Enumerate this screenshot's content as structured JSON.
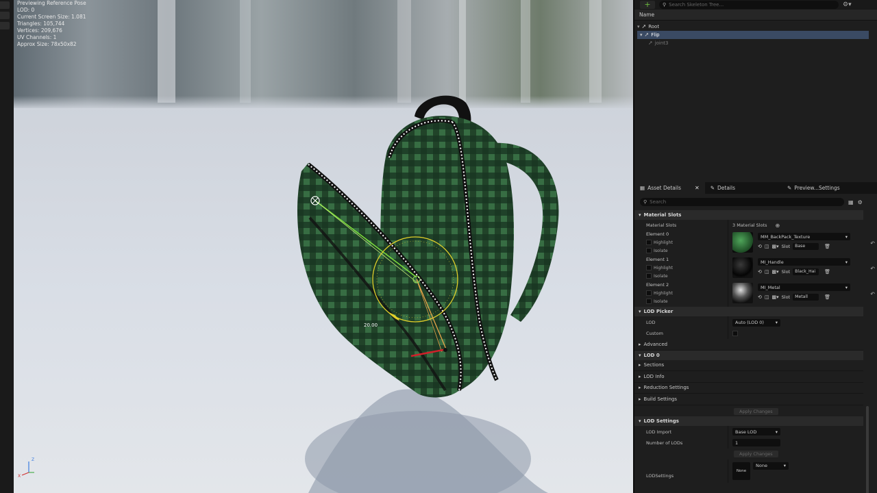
{
  "viewport": {
    "stats": [
      "Previewing Reference Pose",
      "LOD: 0",
      "Current Screen Size: 1.081",
      "Triangles: 105,744",
      "Vertices: 209,676",
      "UV Channels: 1",
      "Approx Size: 78x50x82"
    ],
    "gizmo_value": "20.00",
    "axis_z": "Z",
    "axis_x": "X"
  },
  "skeleton_tree": {
    "search_placeholder": "Search Skeleton Tree...",
    "column_header": "Name",
    "bones": [
      {
        "label": "Root",
        "state": "normal"
      },
      {
        "label": "Flip",
        "state": "selected"
      },
      {
        "label": "joint3",
        "state": "dim"
      }
    ]
  },
  "tabs": [
    {
      "label": "Asset Details",
      "icon": "asset-details-icon",
      "active": true
    },
    {
      "label": "Details",
      "icon": "pencil-icon",
      "active": false
    },
    {
      "label": "Preview...Settings",
      "icon": "pencil-icon",
      "active": false
    }
  ],
  "details": {
    "search_placeholder": "Search",
    "material_slots": {
      "header": "Material Slots",
      "row_label": "Material Slots",
      "count_label": "3 Material Slots",
      "elements": [
        {
          "name": "Element 0",
          "highlight": "Highlight",
          "isolate": "Isolate",
          "material": "MM_BackPack_Texture",
          "slot_label": "Slot",
          "slot": "Base",
          "thumb_color": "#2f8a3a"
        },
        {
          "name": "Element 1",
          "highlight": "Highlight",
          "isolate": "Isolate",
          "material": "MI_Handle",
          "slot_label": "Slot",
          "slot": "Black_Hai",
          "thumb_color": "#050505"
        },
        {
          "name": "Element 2",
          "highlight": "Highlight",
          "isolate": "Isolate",
          "material": "MI_Metal",
          "slot_label": "Slot",
          "slot": "Metall",
          "thumb_color": "#2a2a2a"
        }
      ]
    },
    "lod_picker": {
      "header": "LOD Picker",
      "lod_label": "LOD",
      "lod_value": "Auto (LOD 0)",
      "custom_label": "Custom",
      "advanced": "Advanced"
    },
    "lod0": {
      "header": "LOD 0",
      "sections": [
        "Sections",
        "LOD Info",
        "Reduction Settings",
        "Build Settings"
      ],
      "apply_label": "Apply Changes"
    },
    "lod_settings": {
      "header": "LOD Settings",
      "import_label": "LOD Import",
      "import_value": "Base LOD",
      "num_lods_label": "Number of LODs",
      "num_lods_value": "1",
      "apply_label": "Apply Changes",
      "lodsettings_label": "LODSettings",
      "lodsettings_thumb": "None",
      "lodsettings_value": "None"
    }
  },
  "colors": {
    "selection": "#3a4a63",
    "accent_green": "#6dbb3f"
  }
}
